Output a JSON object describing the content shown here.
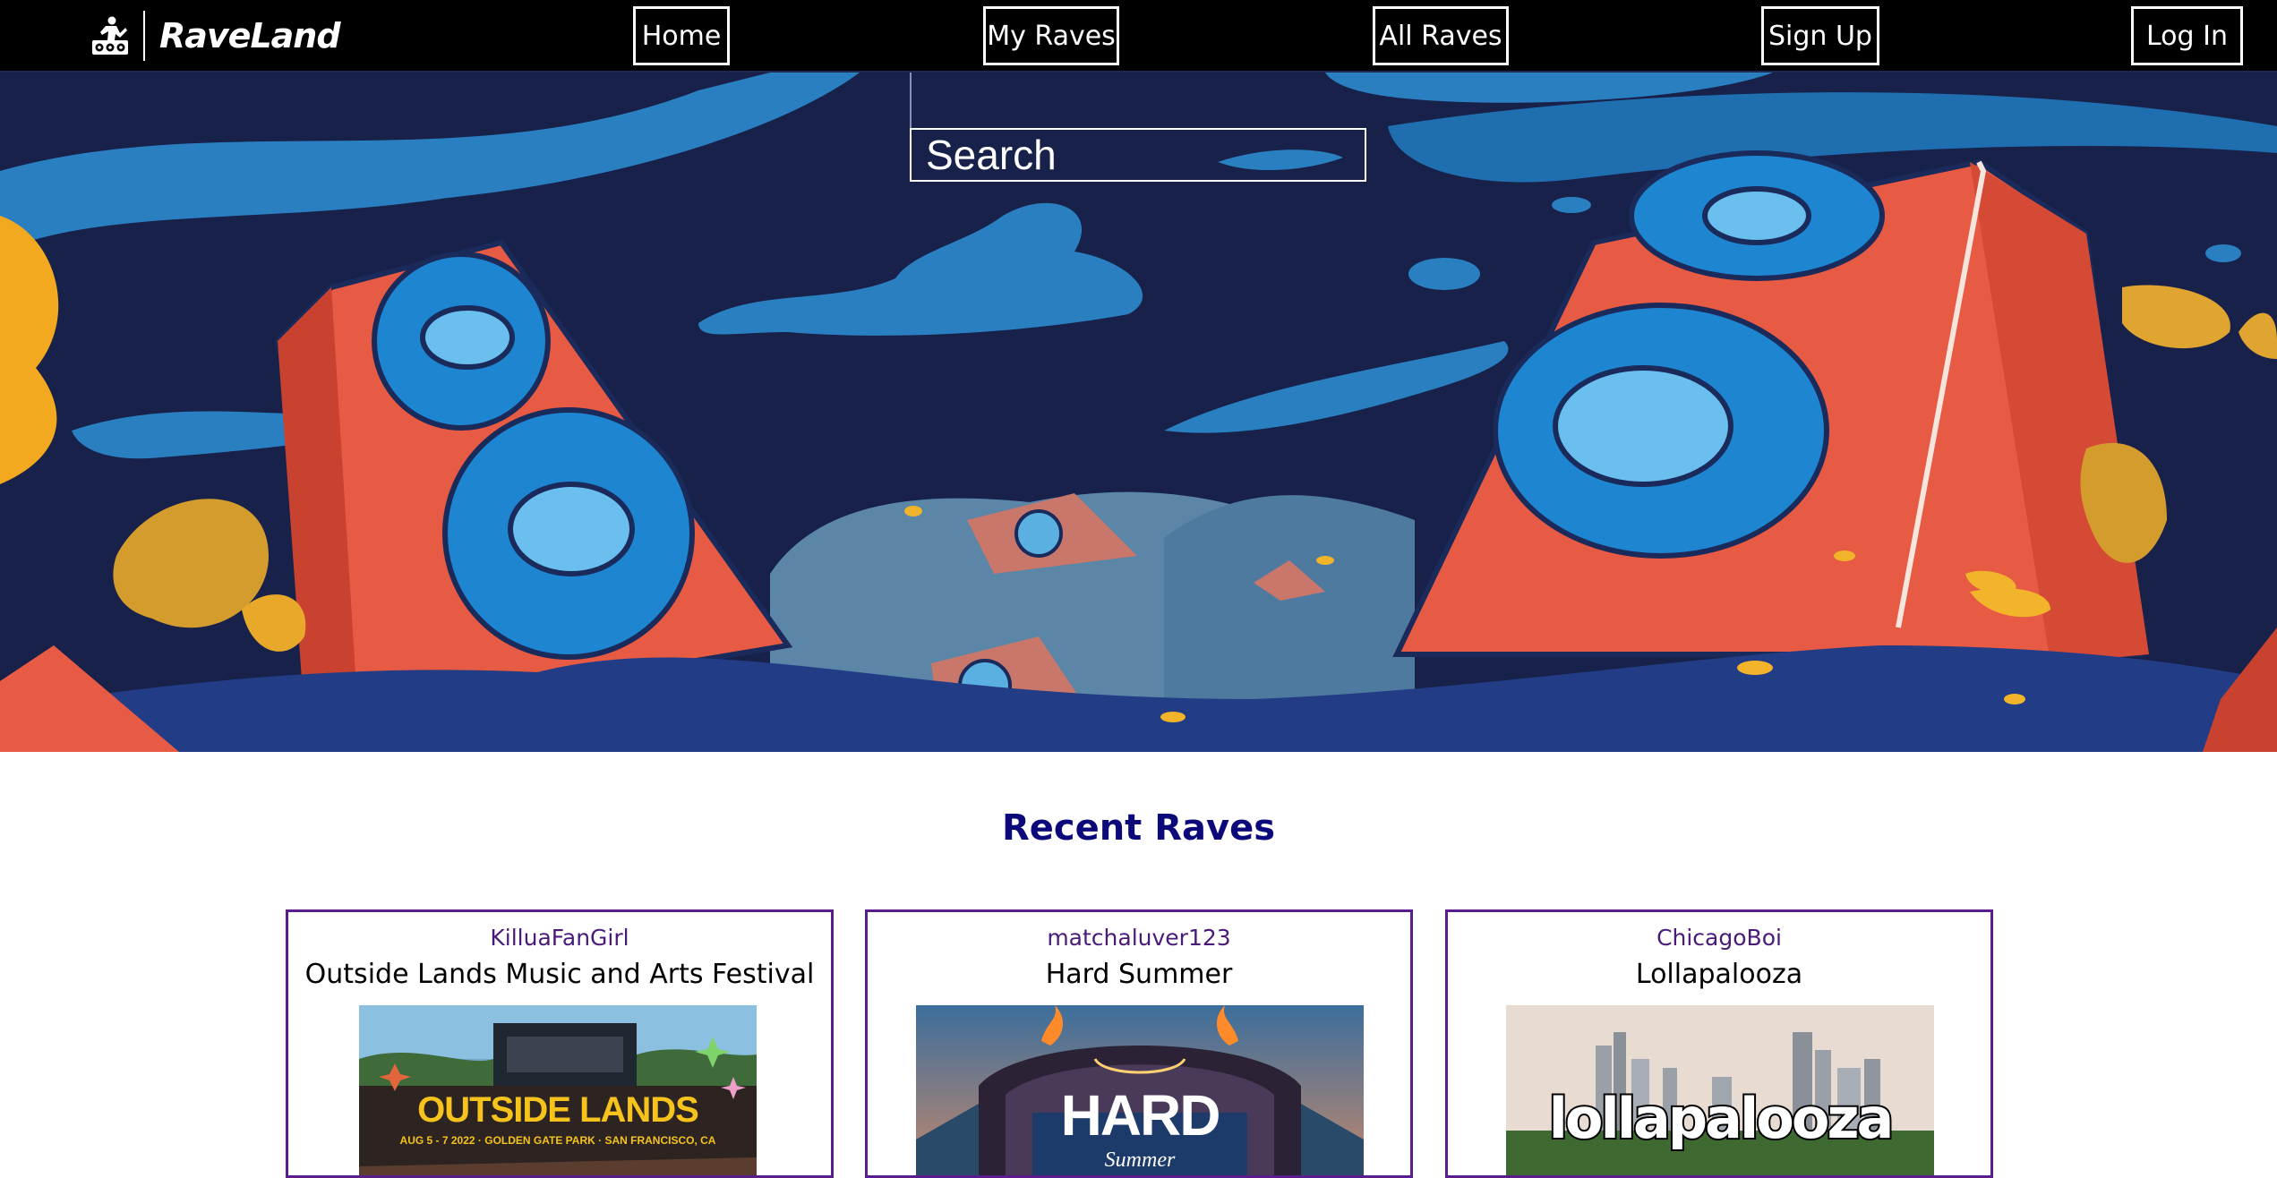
{
  "brand": {
    "name": "RaveLand",
    "icon": "dj-turntable-icon"
  },
  "nav": {
    "home": "Home",
    "my_raves": "My Raves",
    "all_raves": "All Raves",
    "sign_up": "Sign Up",
    "log_in": "Log In"
  },
  "search": {
    "placeholder": "Search",
    "value": ""
  },
  "hero": {
    "image": "festival-speakers-illustration"
  },
  "recent": {
    "title": "Recent Raves",
    "cards": [
      {
        "user": "KilluaFanGirl",
        "title": "Outside Lands Music and Arts Festival",
        "image": "outside-lands-poster",
        "image_headline": "OUTSIDE LANDS",
        "image_caption": "AUG 5 - 7 2022 · GOLDEN GATE PARK · SAN FRANCISCO, CA"
      },
      {
        "user": "matchaluver123",
        "title": "Hard Summer",
        "image": "hard-summer-stage",
        "image_headline": "HARD",
        "image_caption": "Summer"
      },
      {
        "user": "ChicagoBoi",
        "title": "Lollapalooza",
        "image": "lollapalooza-skyline",
        "image_headline": "lollapalooza"
      }
    ]
  },
  "colors": {
    "navbar": "#000000",
    "title": "#0c0a7a",
    "card_border": "#5a1e8c",
    "card_user": "#4a1a7a"
  }
}
